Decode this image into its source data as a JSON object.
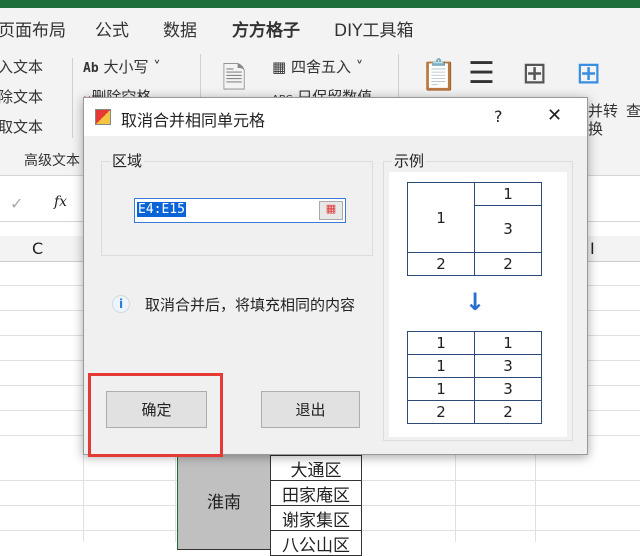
{
  "ribbon_tabs": [
    "页面布局",
    "公式",
    "数据",
    "方方格子",
    "DIY工具箱"
  ],
  "active_tab": "方方格子",
  "ribbon": {
    "insert_text": "入文本",
    "delete_text": "除文本",
    "extract_text": "取文本",
    "case": "大小写",
    "case_icon": "Ab",
    "remove_space": "删除空格",
    "round": "四舍五入",
    "keep_value": "只保留数值",
    "group_label": "高级文本",
    "merge_convert": "并转",
    "merge_convert2": "换",
    "lookup": "查"
  },
  "formula_bar": {
    "check": "✓",
    "fx": "fx"
  },
  "columns": [
    "C",
    "I"
  ],
  "dialog": {
    "title": "取消合并相同单元格",
    "help": "?",
    "close": "✕",
    "range_label": "区域",
    "range_value": "E4:E15",
    "info_text": "取消合并后，将填充相同的内容",
    "ok": "确定",
    "exit": "退出",
    "example_label": "示例",
    "example_before": [
      [
        "1",
        "1"
      ],
      [
        "",
        "3"
      ],
      [
        "2",
        "2"
      ]
    ],
    "example_after": [
      [
        "1",
        "1"
      ],
      [
        "1",
        "3"
      ],
      [
        "1",
        "3"
      ],
      [
        "2",
        "2"
      ]
    ]
  },
  "sheet": {
    "merged": "淮南",
    "cells": [
      "大通区",
      "田家庵区",
      "谢家集区",
      "八公山区"
    ]
  },
  "colors": {
    "highlight": "#e53935",
    "accent": "#1e6e3c",
    "table_border": "#2c4a7a"
  }
}
